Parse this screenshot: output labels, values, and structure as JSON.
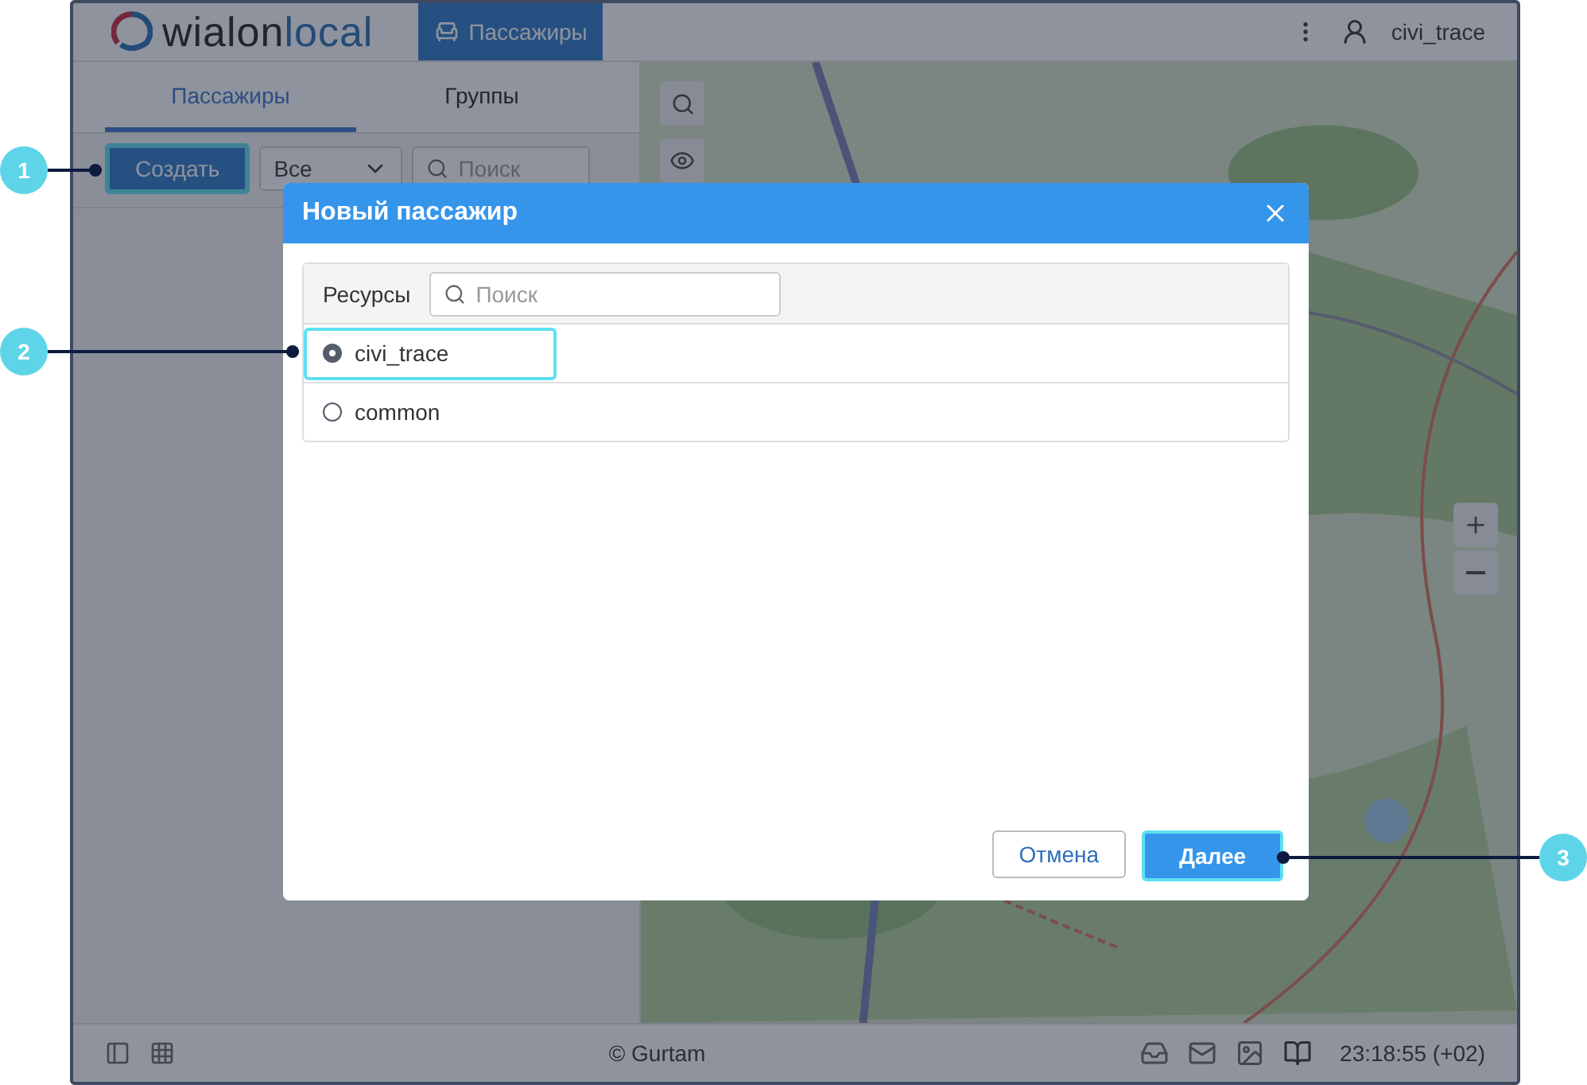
{
  "header": {
    "logo": {
      "name": "wialon",
      "suffix": "local"
    },
    "nav_tabs": [
      {
        "label": "Пассажиры",
        "selected": true
      }
    ],
    "user": "civi_trace"
  },
  "sidebar": {
    "tabs": [
      {
        "label": "Пассажиры",
        "selected": true
      },
      {
        "label": "Группы",
        "selected": false
      }
    ],
    "create_button": "Создать",
    "filter": {
      "value": "Все"
    },
    "search": {
      "placeholder": "Поиск"
    }
  },
  "footer": {
    "copyright": "© Gurtam",
    "time": "23:18:55 (+02)"
  },
  "dialog": {
    "title": "Новый пассажир",
    "resources_label": "Ресурсы",
    "search": {
      "placeholder": "Поиск"
    },
    "resources": [
      {
        "name": "civi_trace",
        "selected": true
      },
      {
        "name": "common",
        "selected": false
      }
    ],
    "buttons": [
      {
        "label": "Отмена",
        "kind": "secondary"
      },
      {
        "label": "Далее",
        "kind": "primary"
      }
    ]
  },
  "callouts": [
    {
      "number": "1"
    },
    {
      "number": "2"
    },
    {
      "number": "3"
    }
  ]
}
